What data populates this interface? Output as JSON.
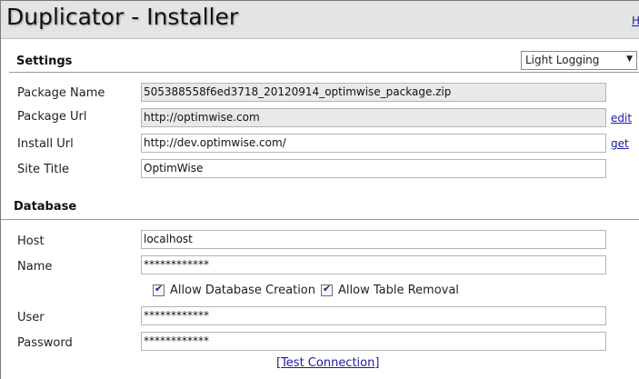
{
  "app": {
    "title": "Duplicator - Installer",
    "help_link": "Help"
  },
  "settings": {
    "title": "Settings",
    "logging": {
      "selected": "Light Logging"
    },
    "package_name": {
      "label": "Package Name",
      "value": "505388558f6ed3718_20120914_optimwise_package.zip"
    },
    "package_url": {
      "label": "Package Url",
      "value": "http://optimwise.com",
      "link": "edit"
    },
    "install_url": {
      "label": "Install Url",
      "value": "http://dev.optimwise.com/",
      "link": "get"
    },
    "site_title": {
      "label": "Site Title",
      "value": "OptimWise"
    }
  },
  "database": {
    "title": "Database",
    "host": {
      "label": "Host",
      "value": "localhost"
    },
    "name": {
      "label": "Name",
      "value": "************"
    },
    "allow_db_creation": {
      "label": "Allow Database Creation",
      "checked": true
    },
    "allow_table_removal": {
      "label": "Allow Table Removal",
      "checked": true
    },
    "user": {
      "label": "User",
      "value": "************"
    },
    "password": {
      "label": "Password",
      "value": "************"
    },
    "test_connection": "[Test Connection]"
  }
}
